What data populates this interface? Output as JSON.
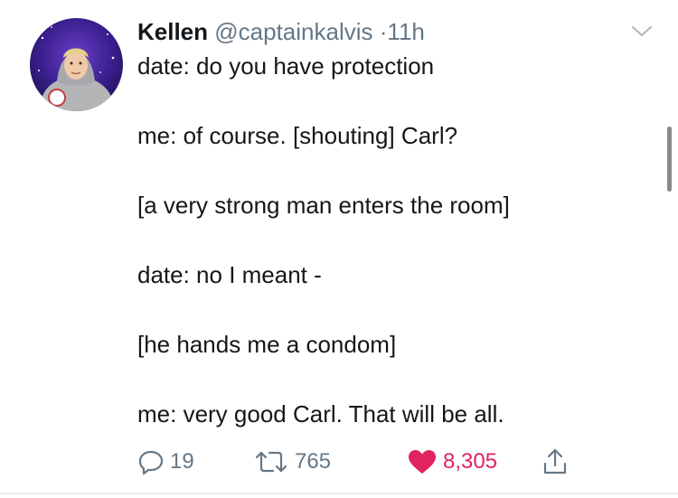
{
  "tweet": {
    "author": {
      "name": "Kellen",
      "handle": "@captainkalvis",
      "separator": "·",
      "time": "11h"
    },
    "lines": [
      "date: do you have protection",
      "me: of course. [shouting] Carl?",
      "[a very strong man enters the room]",
      "date: no I meant -",
      "[he hands me a condom]",
      "me: very good Carl. That will be all."
    ],
    "actions": {
      "replies": "19",
      "retweets": "765",
      "likes": "8,305"
    }
  },
  "icons": {
    "reply": "reply-icon",
    "retweet": "retweet-icon",
    "like": "heart-icon",
    "share": "share-icon",
    "menu": "chevron-down-icon"
  },
  "colors": {
    "text": "#14171a",
    "muted": "#657786",
    "like": "#e0245e"
  }
}
